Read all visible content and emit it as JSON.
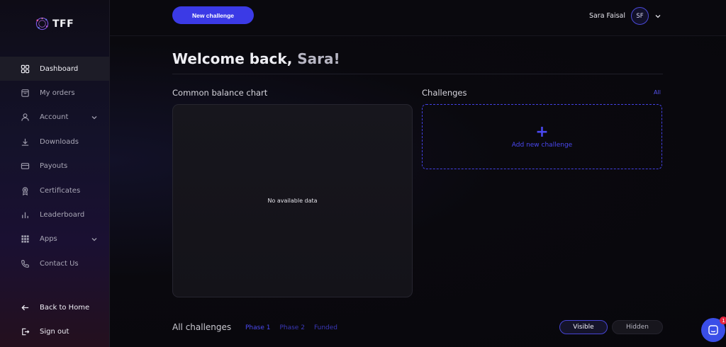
{
  "brand": {
    "name": "TFF"
  },
  "sidebar": {
    "items": [
      {
        "label": "Dashboard",
        "icon": "grid-icon",
        "active": true
      },
      {
        "label": "My orders",
        "icon": "orders-icon"
      },
      {
        "label": "Account",
        "icon": "user-icon",
        "expandable": true
      },
      {
        "label": "Downloads",
        "icon": "download-icon"
      },
      {
        "label": "Payouts",
        "icon": "wallet-icon"
      },
      {
        "label": "Certificates",
        "icon": "certificate-icon"
      },
      {
        "label": "Leaderboard",
        "icon": "bar-chart-icon"
      },
      {
        "label": "Apps",
        "icon": "apps-grid-icon",
        "expandable": true
      },
      {
        "label": "Contact Us",
        "icon": "phone-icon"
      }
    ],
    "bottom": [
      {
        "label": "Back to Home",
        "icon": "arrow-left-icon"
      },
      {
        "label": "Sign out",
        "icon": "sign-out-icon"
      }
    ]
  },
  "topbar": {
    "new_challenge": "New challenge",
    "user_name": "Sara Faisal",
    "avatar_initials": "SF"
  },
  "main": {
    "welcome_prefix": "Welcome back, ",
    "welcome_name": "Sara!",
    "balance_title": "Common balance chart",
    "no_data": "No available data",
    "challenges_title": "Challenges",
    "all_link": "All",
    "add_plus": "+",
    "add_label": "Add new challenge",
    "all_challenges_title": "All challenges",
    "phase_tabs": [
      "Phase 1",
      "Phase 2",
      "Funded"
    ],
    "visibility": {
      "visible": "Visible",
      "hidden": "Hidden"
    }
  },
  "chat": {
    "badge": "1"
  },
  "colors": {
    "accent": "#3b3ae6",
    "badge": "#e5233d"
  }
}
